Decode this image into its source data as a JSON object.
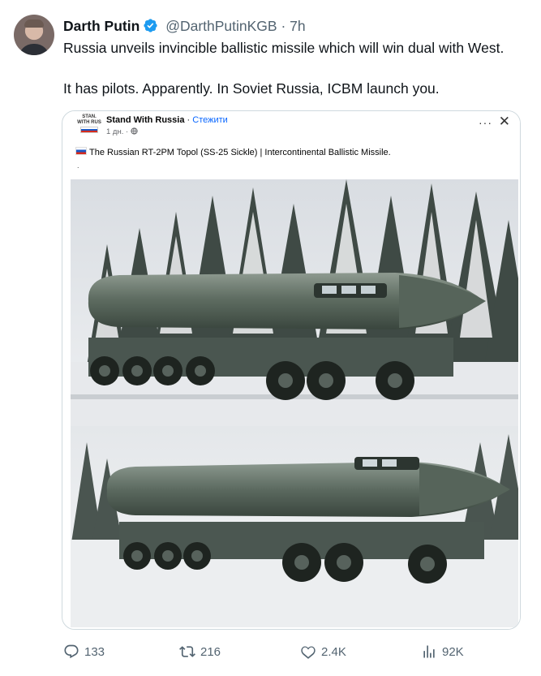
{
  "tweet": {
    "author_name": "Darth Putin",
    "handle": "@DarthPutinKGB",
    "separator": "·",
    "time": "7h",
    "text_line1": "Russia unveils invincible ballistic missile which will win dual with West.",
    "text_line2": "It has pilots. Apparently. In Soviet Russia, ICBM launch you."
  },
  "embedded_post": {
    "logo_text": "STAN. WITH RUS",
    "page_name": "Stand With Russia",
    "separator": " · ",
    "follow_label": "Стежити",
    "meta": "1 дн. ·",
    "more_label": "···",
    "close_label": "✕",
    "caption": "The Russian RT-2PM Topol (SS-25 Sickle) |  Intercontinental Ballistic Missile.",
    "caption_line2": "."
  },
  "stats": {
    "replies": "133",
    "retweets": "216",
    "likes": "2.4K",
    "views": "92K"
  },
  "icons": {
    "verified": "verified-badge-icon",
    "reply": "reply-icon",
    "retweet": "retweet-icon",
    "like": "heart-icon",
    "views": "bar-chart-icon"
  },
  "colors": {
    "verified": "#1d9bf0",
    "text": "#0f1419",
    "muted": "#536471",
    "border": "#cfd9de",
    "fb_link": "#0866ff"
  }
}
